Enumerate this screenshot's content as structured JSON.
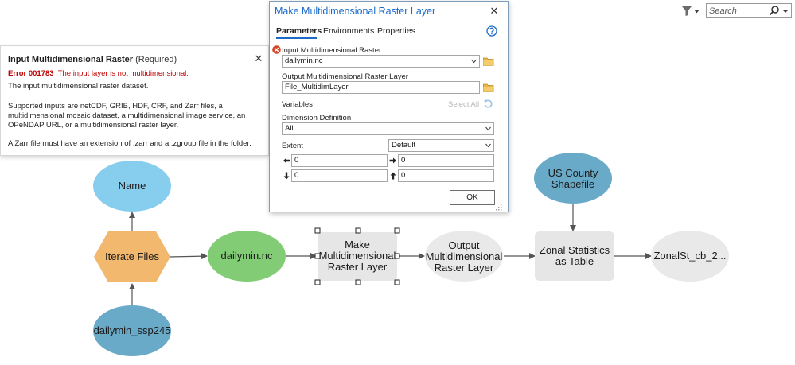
{
  "toolbar": {
    "search_placeholder": "Search",
    "filter_icon": "filter-icon",
    "search_icon": "search-icon"
  },
  "diagram": {
    "nodes": {
      "name": "Name",
      "iterate_files": "Iterate Files",
      "dailymin_ssp245": "dailymin_ssp245",
      "dailymin_nc": "dailymin.nc",
      "make_mdim_line1": "Make",
      "make_mdim_line2": "Multidimensional",
      "make_mdim_line3": "Raster Layer",
      "output_mdim_line1": "Output",
      "output_mdim_line2": "Multidimensional",
      "output_mdim_line3": "Raster Layer",
      "us_county_line1": "US County",
      "us_county_line2": "Shapefile",
      "zonal_stats_line1": "Zonal Statistics",
      "zonal_stats_line2": "as Table",
      "zonalst_output": "ZonalSt_cb_2..."
    },
    "colors": {
      "blue_variable": "#87cdee",
      "dark_blue_variable": "#6aaac9",
      "orange_iterator": "#f2b96e",
      "green_data": "#82cc76",
      "gray_tool": "#e6e6e6",
      "gray_output": "#e9e9e9",
      "connector": "#555555"
    }
  },
  "help_panel": {
    "title": "Input Multidimensional Raster",
    "required": "(Required)",
    "error_code": "Error 001783",
    "error_message": "The input layer is not multidimensional.",
    "line1": "The input multidimensional raster dataset.",
    "para2": "Supported inputs are netCDF, GRIB, HDF, CRF, and Zarr files, a multidimensional mosaic dataset, a multidimensional image service, an OPeNDAP URL, or a multidimensional raster layer.",
    "para3": "A Zarr file must have an extension of .zarr and a .zgroup file in the folder.",
    "close": "✕"
  },
  "dialog": {
    "title": "Make Multidimensional Raster Layer",
    "close": "✕",
    "tabs": [
      "Parameters",
      "Environments",
      "Properties"
    ],
    "input_raster_label": "Input Multidimensional Raster",
    "input_raster_value": "dailymin.nc",
    "output_layer_label": "Output Multidimensional Raster Layer",
    "output_layer_value": "File_MultidimLayer",
    "variables_label": "Variables",
    "select_all": "Select All",
    "dimension_def_label": "Dimension Definition",
    "dimension_def_value": "All",
    "extent_label": "Extent",
    "extent_value": "Default",
    "left_value": "0",
    "right_value": "0",
    "bottom_value": "0",
    "top_value": "0",
    "ok": "OK",
    "accent": "#1b6ac9",
    "error_color": "#c00000"
  }
}
